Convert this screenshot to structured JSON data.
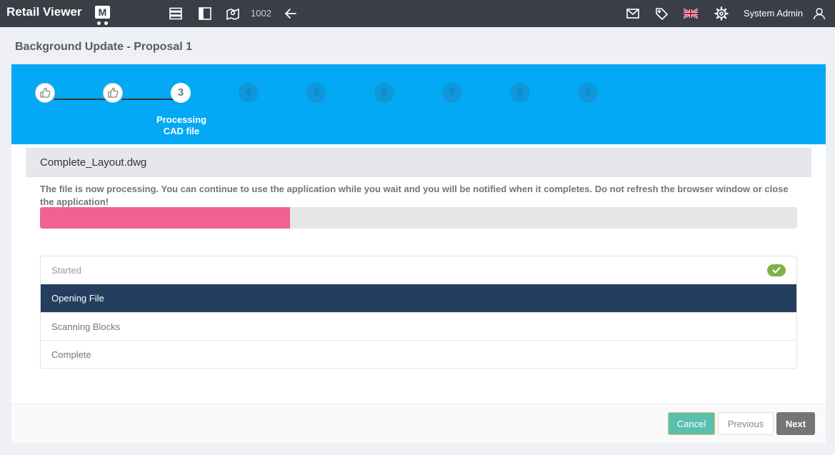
{
  "app": {
    "logo_text": "Retail Viewer",
    "logo_mark": "M",
    "nav_icons": [
      "list-icon",
      "layout-icon",
      "map-icon"
    ],
    "store_number": "1002",
    "back_icon": "arrow-left-icon",
    "right_icons": [
      "mail-icon",
      "tag-icon",
      "uk-flag-icon",
      "gear-icon"
    ],
    "user_name": "System Admin",
    "user_icon": "user-icon"
  },
  "page": {
    "title": "Background Update - Proposal 1"
  },
  "stepper": {
    "steps": [
      {
        "label": "",
        "status": "done",
        "icon": "thumbs-up-icon"
      },
      {
        "label": "",
        "status": "done",
        "icon": "thumbs-up-icon"
      },
      {
        "label": "3",
        "status": "current"
      },
      {
        "label": "4",
        "status": "todo"
      },
      {
        "label": "5",
        "status": "todo"
      },
      {
        "label": "6",
        "status": "todo"
      },
      {
        "label": "7",
        "status": "todo"
      },
      {
        "label": "8",
        "status": "todo"
      },
      {
        "label": "9",
        "status": "todo"
      }
    ],
    "current_label_line1": "Processing",
    "current_label_line2": "CAD file"
  },
  "file": {
    "name": "Complete_Layout.dwg",
    "notice": "The file is now processing. You can continue to use the application while you wait and you will be notified when it completes. Do not refresh the browser window or close the application!",
    "progress_fraction": 0.33
  },
  "status_items": [
    {
      "label": "Started",
      "state": "done"
    },
    {
      "label": "Opening File",
      "state": "active"
    },
    {
      "label": "Scanning Blocks",
      "state": "pending"
    },
    {
      "label": "Complete",
      "state": "pending"
    }
  ],
  "footer": {
    "cancel_label": "Cancel",
    "previous_label": "Previous",
    "next_label": "Next"
  },
  "colors": {
    "topbar": "#3a3f47",
    "stepper": "#03a9f4",
    "progress": "#f06292",
    "active_row": "#233e5e",
    "check": "#7cb342",
    "cancel": "#5bbfb0"
  }
}
